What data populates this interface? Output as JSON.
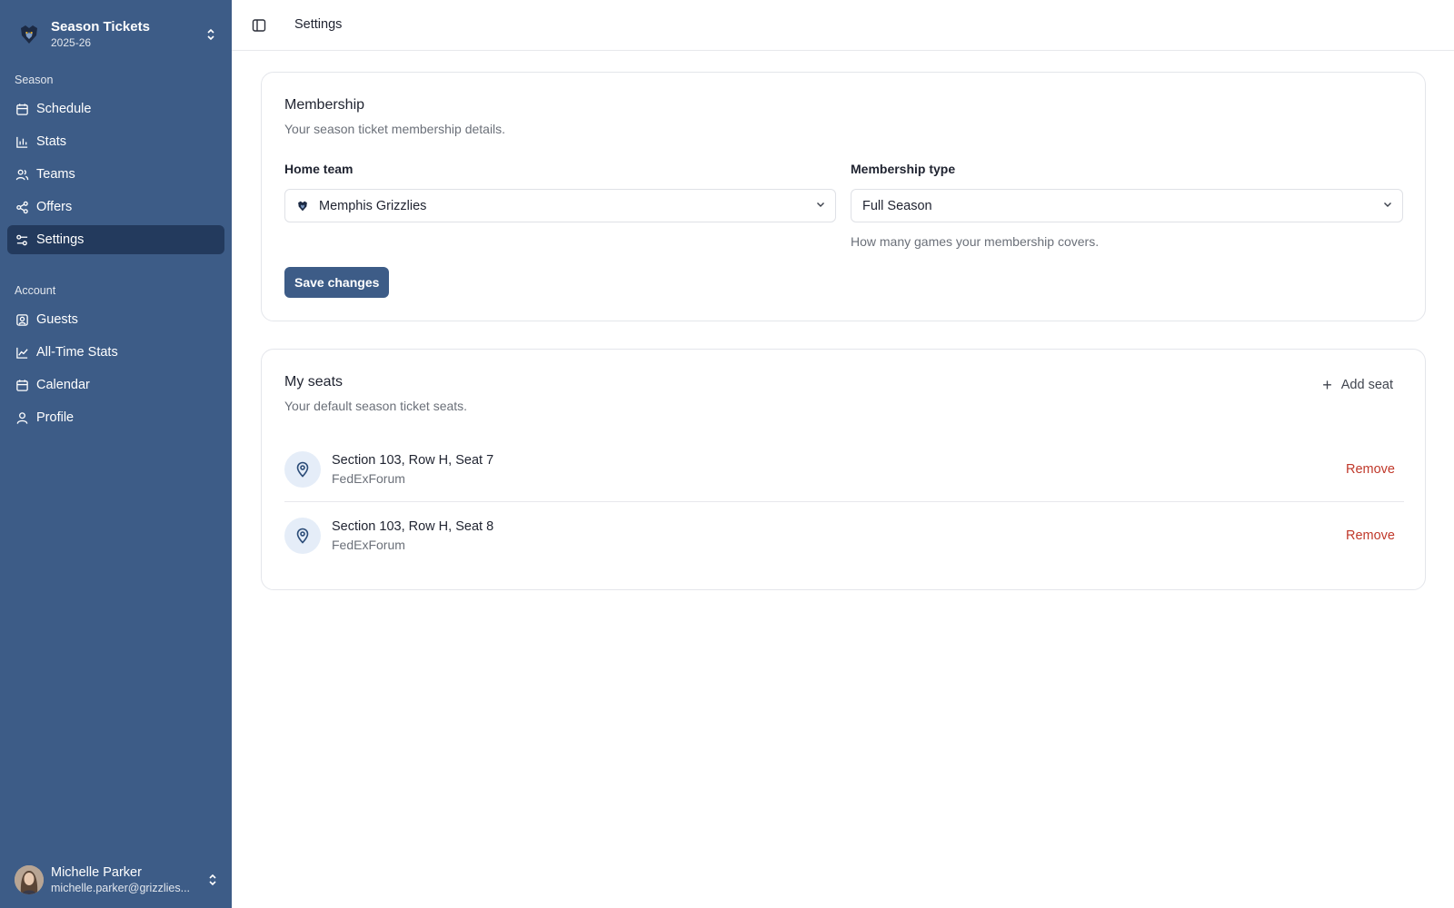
{
  "sidebar": {
    "brand": {
      "title": "Season Tickets",
      "subtitle": "2025-26",
      "logo_icon": "grizzlies-logo-icon"
    },
    "groups": [
      {
        "label": "Season",
        "items": [
          {
            "label": "Schedule",
            "icon": "calendar-icon"
          },
          {
            "label": "Stats",
            "icon": "bar-chart-icon"
          },
          {
            "label": "Teams",
            "icon": "users-icon"
          },
          {
            "label": "Offers",
            "icon": "share-icon"
          },
          {
            "label": "Settings",
            "icon": "sliders-icon",
            "active": true
          }
        ]
      },
      {
        "label": "Account",
        "items": [
          {
            "label": "Guests",
            "icon": "contact-icon"
          },
          {
            "label": "All-Time Stats",
            "icon": "line-chart-icon"
          },
          {
            "label": "Calendar",
            "icon": "calendar-icon"
          },
          {
            "label": "Profile",
            "icon": "user-icon"
          }
        ]
      }
    ],
    "user": {
      "name": "Michelle Parker",
      "email": "michelle.parker@grizzlies..."
    }
  },
  "header": {
    "breadcrumb": "Settings"
  },
  "membership": {
    "title": "Membership",
    "description": "Your season ticket membership details.",
    "home_team_label": "Home team",
    "home_team_value": "Memphis Grizzlies",
    "membership_type_label": "Membership type",
    "membership_type_value": "Full Season",
    "membership_type_hint": "How many games your membership covers.",
    "save_label": "Save changes"
  },
  "seats": {
    "title": "My seats",
    "description": "Your default season ticket seats.",
    "add_label": "Add seat",
    "remove_label": "Remove",
    "items": [
      {
        "name": "Section 103, Row H, Seat 7",
        "venue": "FedExForum"
      },
      {
        "name": "Section 103, Row H, Seat 8",
        "venue": "FedExForum"
      }
    ]
  },
  "colors": {
    "sidebar": "#3d5c87",
    "sidebar_active": "#233a5d",
    "primary": "#3d5c87",
    "danger": "#c0392b"
  }
}
